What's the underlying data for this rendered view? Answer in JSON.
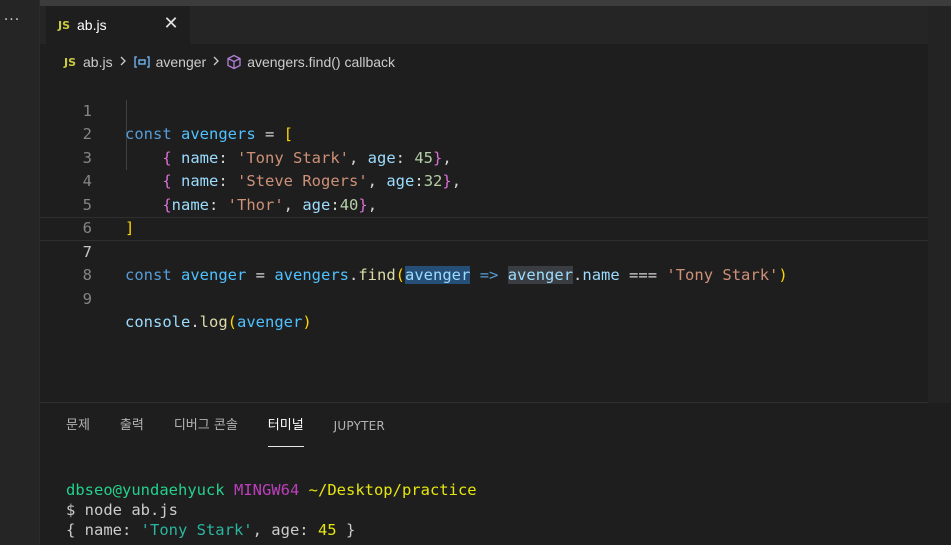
{
  "activity": {
    "more_label": "···"
  },
  "tab": {
    "badge": "JS",
    "label": "ab.js",
    "close_glyph": "✕"
  },
  "breadcrumb": {
    "badge": "JS",
    "file": "ab.js",
    "symbol1": "avenger",
    "symbol2": "avengers.find() callback",
    "symbol1_icon": "variable-icon",
    "symbol2_icon": "method-cube-icon"
  },
  "editor": {
    "line_numbers": [
      "1",
      "2",
      "3",
      "4",
      "5",
      "6",
      "7",
      "8",
      "9"
    ],
    "active_line": 7,
    "tokens": {
      "const": "const",
      "avengers": "avengers",
      "eq": " = ",
      "lbr": "[",
      "rbr": "]",
      "lc": "{",
      "rc": "}",
      "name_key": "name",
      "age_key": "age",
      "tony": "'Tony Stark'",
      "steve": "'Steve Rogers'",
      "thor": "'Thor'",
      "n45": "45",
      "n32": "32",
      "n40": "40",
      "avenger": "avenger",
      "find": "find",
      "arrow": "=>",
      "name_prop": "name",
      "strict_eq": "===",
      "console": "console",
      "log": "log"
    }
  },
  "panel": {
    "tabs": [
      "문제",
      "출력",
      "디버그 콘솔",
      "터미널",
      "JUPYTER"
    ],
    "active_tab": "터미널"
  },
  "terminal": {
    "user_host": "dbseo@yundaehyuck",
    "env": "MINGW64",
    "path": "~/Desktop/practice",
    "command": "$ node ab.js",
    "out_open": "{ name: ",
    "out_str": "'Tony Stark'",
    "out_mid": ", age: ",
    "out_num": "45",
    "out_close": " }"
  },
  "colors": {
    "keyword": "#569cd6",
    "variable": "#4fc1ff",
    "property": "#9cdcfe",
    "string": "#ce9178",
    "number": "#b5cea8",
    "function": "#dcdcaa",
    "bracket_gold": "#ffd700",
    "bracket_orchid": "#da70d6"
  }
}
